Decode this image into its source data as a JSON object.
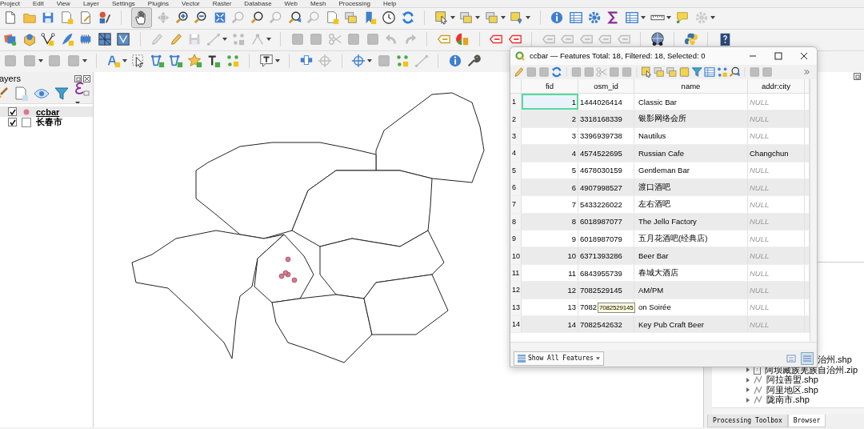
{
  "menu_bar": [
    "Project",
    "Edit",
    "View",
    "Layer",
    "Settings",
    "Plugins",
    "Vector",
    "Raster",
    "Database",
    "Web",
    "Mesh",
    "Processing",
    "Help"
  ],
  "layers_panel": {
    "title": "ayers",
    "layers": [
      {
        "name": "ccbar",
        "checked": true,
        "selected": true,
        "kind": "point",
        "color": "#d9788f"
      },
      {
        "name": "长春市",
        "checked": true,
        "selected": false,
        "kind": "polygon"
      }
    ]
  },
  "attribute_table": {
    "title": "ccbar — Features Total: 18, Filtered: 18, Selected: 0",
    "columns": [
      "fid",
      "osm_id",
      "name",
      "addr:city"
    ],
    "rows": [
      {
        "number": "1",
        "fid": "1",
        "osm_id": "1444026414",
        "name": "Classic Bar",
        "city": "NULL",
        "city_null": true,
        "focused": true
      },
      {
        "number": "2",
        "fid": "2",
        "osm_id": "3318168339",
        "name": "银影网络会所",
        "city": "NULL",
        "city_null": true,
        "focused": false
      },
      {
        "number": "3",
        "fid": "3",
        "osm_id": "3396939738",
        "name": "Nautilus",
        "city": "NULL",
        "city_null": true,
        "focused": false
      },
      {
        "number": "4",
        "fid": "4",
        "osm_id": "4574522695",
        "name": "Russian Cafe",
        "city": "Changchun",
        "city_null": false,
        "focused": false
      },
      {
        "number": "5",
        "fid": "5",
        "osm_id": "4678030159",
        "name": "Gentleman Bar",
        "city": "NULL",
        "city_null": true,
        "focused": false
      },
      {
        "number": "6",
        "fid": "6",
        "osm_id": "4907998527",
        "name": "渡口酒吧",
        "city": "NULL",
        "city_null": true,
        "focused": false
      },
      {
        "number": "7",
        "fid": "7",
        "osm_id": "5433226022",
        "name": "左右酒吧",
        "city": "NULL",
        "city_null": true,
        "focused": false
      },
      {
        "number": "8",
        "fid": "8",
        "osm_id": "6018987077",
        "name": "The Jello Factory",
        "city": "NULL",
        "city_null": true,
        "focused": false
      },
      {
        "number": "9",
        "fid": "9",
        "osm_id": "6018987079",
        "name": "五月花酒吧(经典店)",
        "city": "NULL",
        "city_null": true,
        "focused": false
      },
      {
        "number": "10",
        "fid": "10",
        "osm_id": "6371393286",
        "name": "Beer Bar",
        "city": "NULL",
        "city_null": true,
        "focused": false
      },
      {
        "number": "11",
        "fid": "11",
        "osm_id": "6843955739",
        "name": "春城大酒店",
        "city": "NULL",
        "city_null": true,
        "focused": false
      },
      {
        "number": "12",
        "fid": "12",
        "osm_id": "7082529145",
        "name": "AM/PM",
        "city": "NULL",
        "city_null": true,
        "focused": false
      },
      {
        "number": "13",
        "fid": "13",
        "osm_id": "7082",
        "name": "on Soirée",
        "city": "NULL",
        "city_null": true,
        "focused": false
      },
      {
        "number": "14",
        "fid": "14",
        "osm_id": "7082542632",
        "name": "Key Pub Craft Beer",
        "city": "NULL",
        "city_null": true,
        "focused": false
      }
    ],
    "tooltip": "7082529145",
    "filter_button": "Show All Features"
  },
  "browser_panel": {
    "items": [
      {
        "name": "治州.shp",
        "kind": "partial"
      },
      {
        "name": "阿坝藏族羌族自治州.zip",
        "kind": "zip"
      },
      {
        "name": "阿拉善盟.shp",
        "kind": "shp"
      },
      {
        "name": "阿里地区.shp",
        "kind": "shp"
      },
      {
        "name": "陇南市.shp",
        "kind": "shp"
      }
    ],
    "tabs": [
      {
        "label": "Processing Toolbox",
        "selected": false
      },
      {
        "label": "Browser",
        "selected": true
      }
    ]
  }
}
